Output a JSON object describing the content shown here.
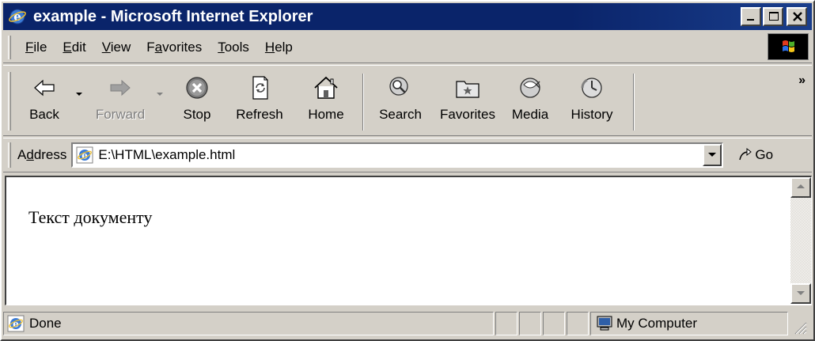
{
  "window": {
    "title": "example - Microsoft Internet Explorer",
    "title_bar_color": "#0a246a",
    "controls": [
      "minimize-icon",
      "maximize-icon",
      "close-icon"
    ]
  },
  "menu": {
    "items": [
      {
        "label": "File",
        "mnemonic": "F"
      },
      {
        "label": "Edit",
        "mnemonic": "E"
      },
      {
        "label": "View",
        "mnemonic": "V"
      },
      {
        "label": "Favorites",
        "mnemonic": "a"
      },
      {
        "label": "Tools",
        "mnemonic": "T"
      },
      {
        "label": "Help",
        "mnemonic": "H"
      }
    ]
  },
  "toolbar": {
    "back": "Back",
    "forward": "Forward",
    "stop": "Stop",
    "refresh": "Refresh",
    "home": "Home",
    "search": "Search",
    "favorites": "Favorites",
    "media": "Media",
    "history": "History",
    "more": "»"
  },
  "address": {
    "label": "Address",
    "url": "E:\\HTML\\example.html",
    "go": "Go"
  },
  "document": {
    "text": "Текст документу"
  },
  "status": {
    "text": "Done",
    "zone": "My Computer"
  }
}
